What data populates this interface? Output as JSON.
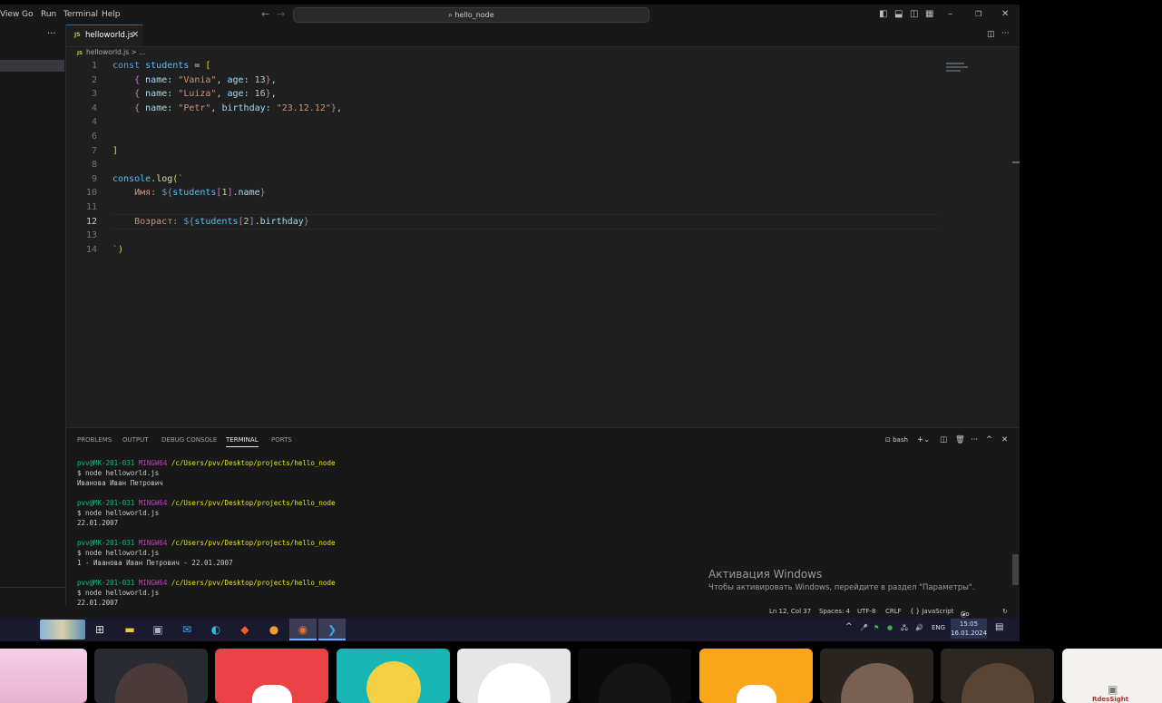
{
  "window": {
    "menu": [
      "View",
      "Go",
      "Run",
      "Terminal",
      "Help"
    ],
    "search_text": "hello_node"
  },
  "tab": {
    "icon": "JS",
    "label": "helloworld.js"
  },
  "breadcrumb": {
    "icon": "JS",
    "text": "helloworld.js > ..."
  },
  "editor": {
    "active_line": 12,
    "lines": [
      "1",
      "2",
      "3",
      "4",
      "6",
      "7",
      "8",
      "9",
      "10",
      "11",
      "12",
      "13",
      "14"
    ]
  },
  "panel": {
    "tabs": [
      "PROBLEMS",
      "OUTPUT",
      "DEBUG CONSOLE",
      "TERMINAL",
      "PORTS"
    ],
    "active_tab": "TERMINAL",
    "shell": "bash",
    "prompt_user": "pvv@MK-201-031",
    "prompt_sys": "MINGW64",
    "prompt_path": "/c/Users/pvv/Desktop/projects/hello_node",
    "command": "$ node helloworld.js",
    "outputs": [
      "Иванова Иван Петрович",
      "22.01.2007",
      "1 - Иванова Иван Петрович - 22.01.2007",
      "22.01.2007"
    ]
  },
  "activation": {
    "title": "Активация Windows",
    "subtitle": "Чтобы активировать Windows, перейдите в раздел \"Параметры\"."
  },
  "status": {
    "position": "Ln 12, Col 37",
    "spaces": "Spaces: 4",
    "encoding": "UTF-8",
    "eol": "CRLF",
    "language": "{ } JavaScript",
    "golive": "Go Live"
  },
  "taskbar": {
    "lang": "ENG",
    "time": "15:05",
    "date": "16.01.2024"
  },
  "thumbnails": {
    "last_label": "RdesSight"
  },
  "colors": {
    "accent": "#0078d4",
    "discord_red": "#ed4245",
    "discord_orange": "#faa61a",
    "teal": "#17b5b5"
  }
}
